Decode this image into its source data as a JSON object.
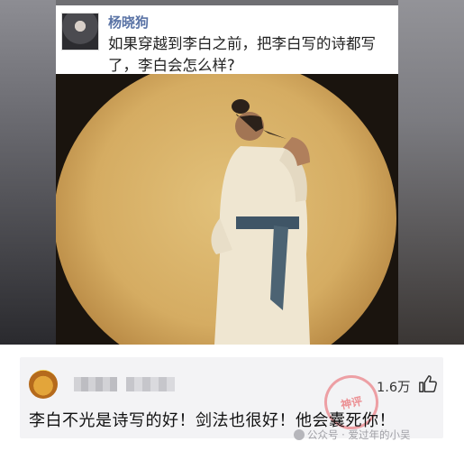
{
  "post": {
    "author": "杨晓狗",
    "question": "如果穿越到李白之前，把李白写的诗都写了，李白会怎么样?"
  },
  "comment": {
    "likes": "1.6万",
    "text": "李白不光是诗写的好！剑法也很好！他会囊死你！",
    "stamp_text": "神评"
  },
  "watermark": {
    "text": "公众号 · 爱过年的小吴"
  },
  "icons": {
    "like": "thumbs-up-icon",
    "watermark": "wechat-icon"
  }
}
